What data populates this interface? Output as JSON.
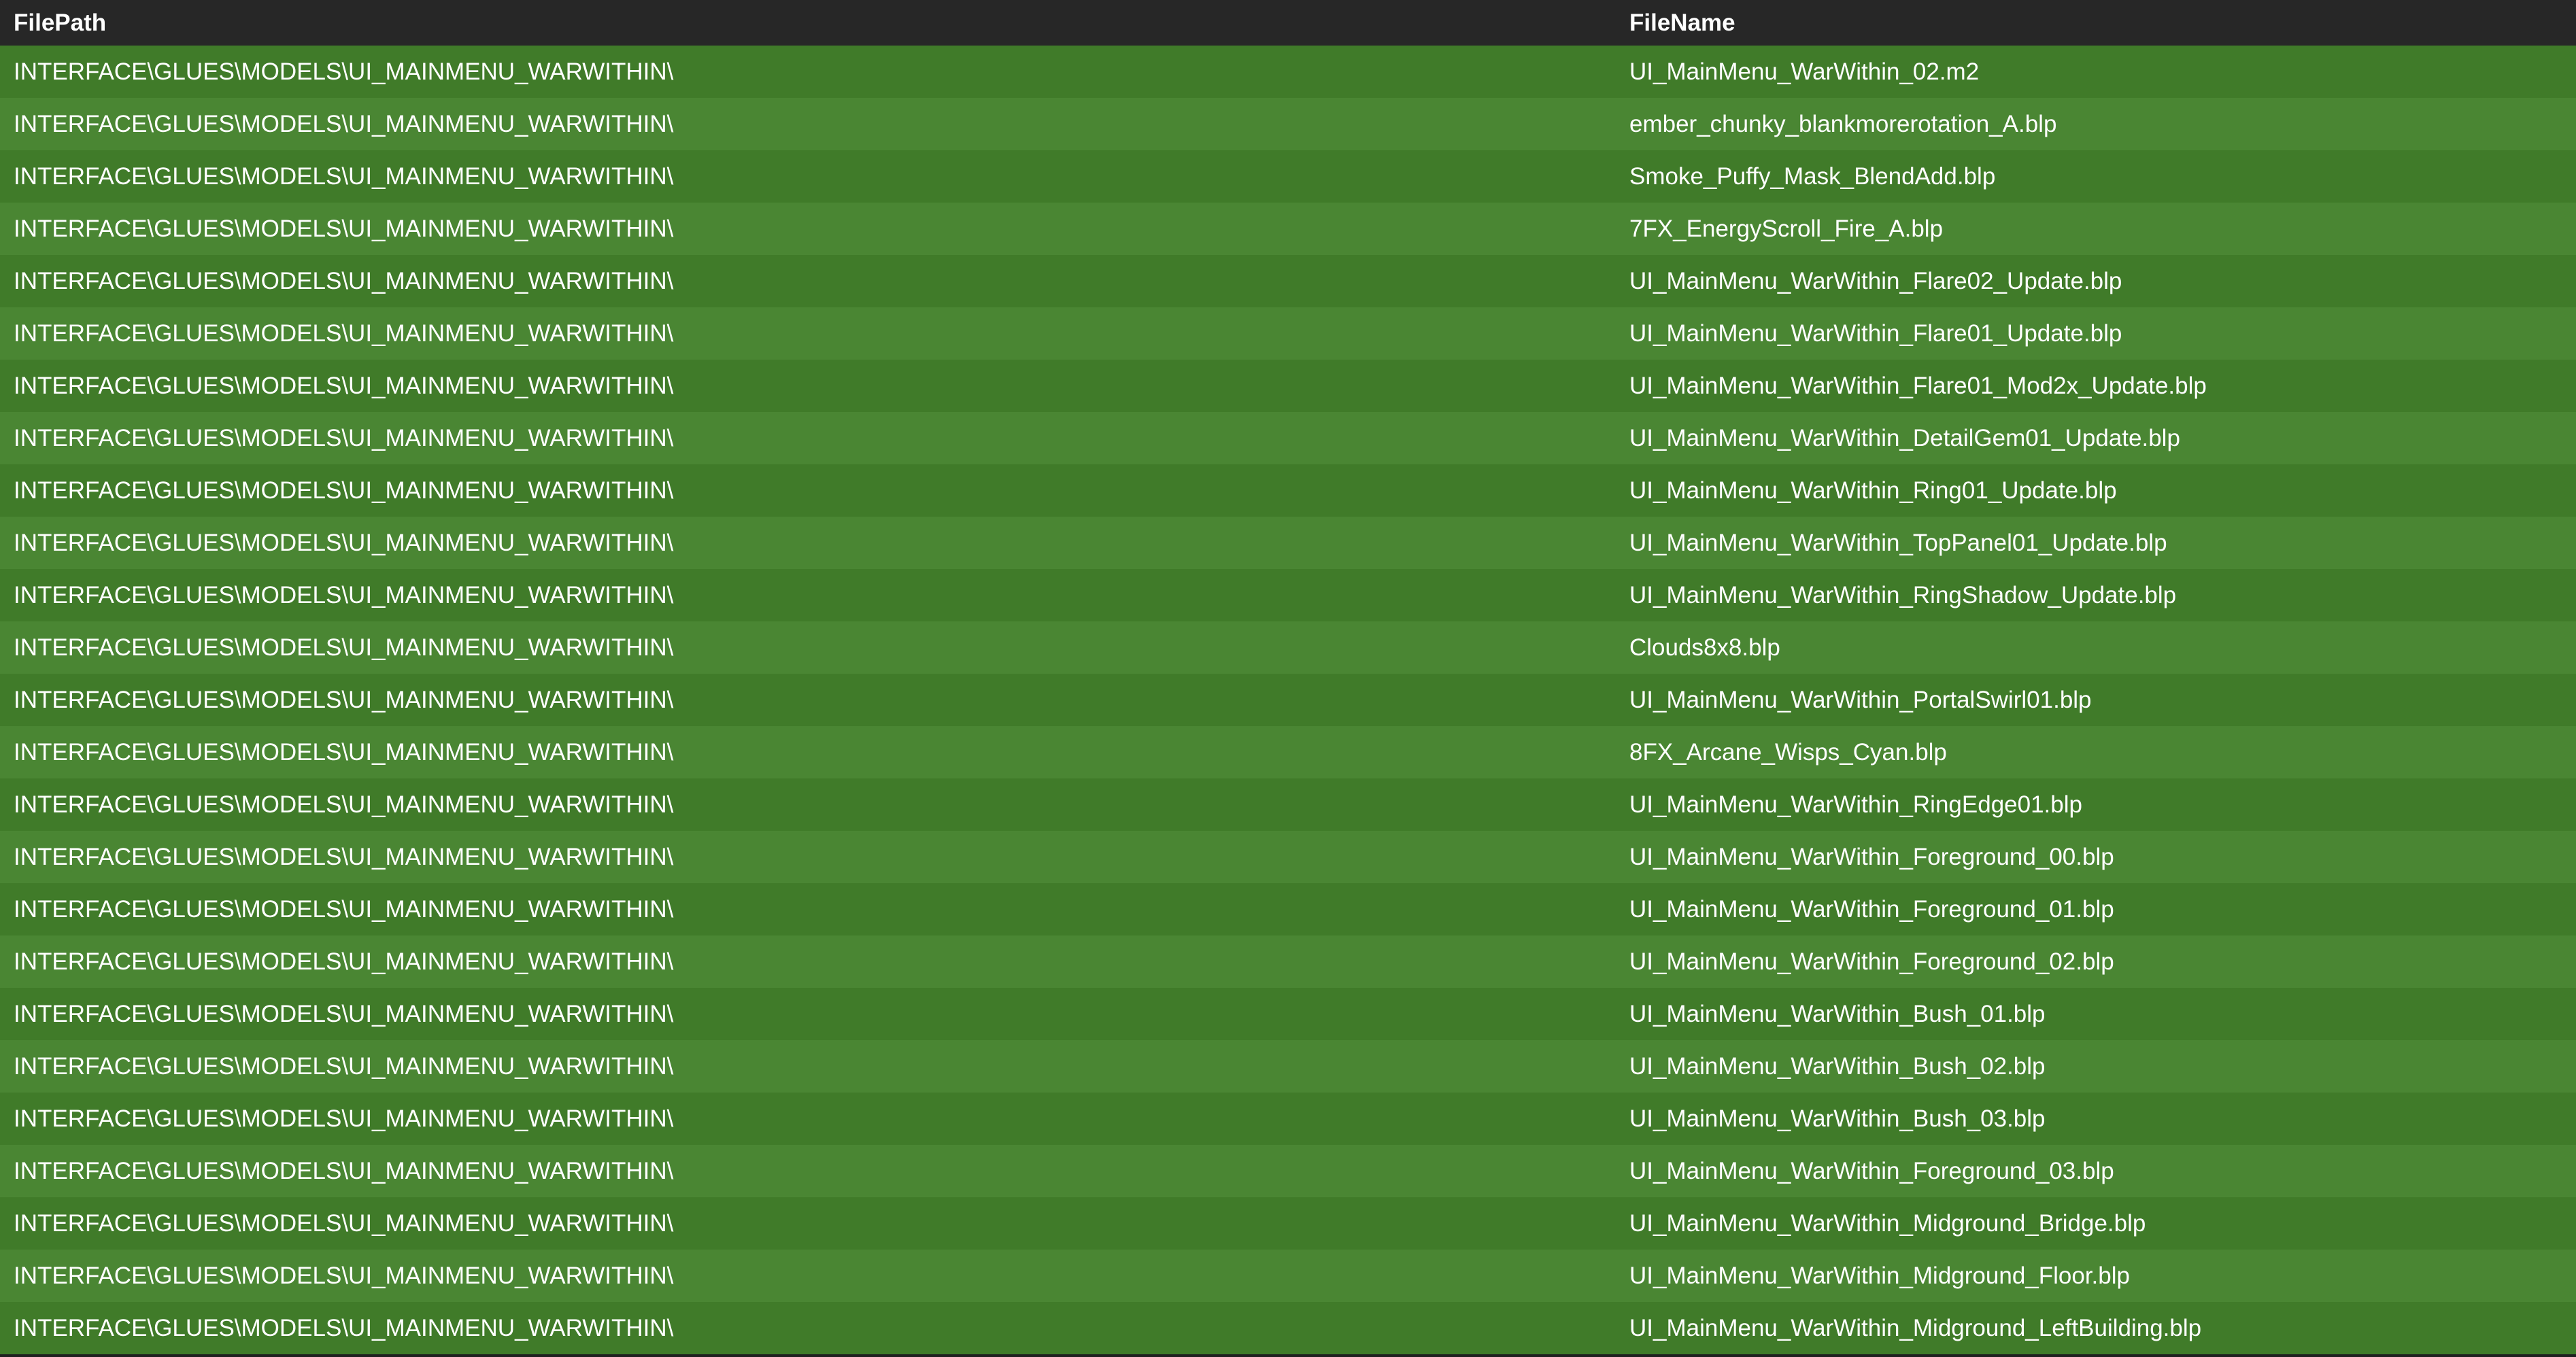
{
  "colors": {
    "header_bg": "#272727",
    "row_odd": "#407b29",
    "row_even": "#4a8633",
    "text": "#ffffff"
  },
  "table": {
    "columns": [
      "FilePath",
      "FileName"
    ],
    "rows": [
      {
        "path": "INTERFACE\\GLUES\\MODELS\\UI_MAINMENU_WARWITHIN\\",
        "name": "UI_MainMenu_WarWithin_02.m2"
      },
      {
        "path": "INTERFACE\\GLUES\\MODELS\\UI_MAINMENU_WARWITHIN\\",
        "name": "ember_chunky_blankmorerotation_A.blp"
      },
      {
        "path": "INTERFACE\\GLUES\\MODELS\\UI_MAINMENU_WARWITHIN\\",
        "name": "Smoke_Puffy_Mask_BlendAdd.blp"
      },
      {
        "path": "INTERFACE\\GLUES\\MODELS\\UI_MAINMENU_WARWITHIN\\",
        "name": "7FX_EnergyScroll_Fire_A.blp"
      },
      {
        "path": "INTERFACE\\GLUES\\MODELS\\UI_MAINMENU_WARWITHIN\\",
        "name": "UI_MainMenu_WarWithin_Flare02_Update.blp"
      },
      {
        "path": "INTERFACE\\GLUES\\MODELS\\UI_MAINMENU_WARWITHIN\\",
        "name": "UI_MainMenu_WarWithin_Flare01_Update.blp"
      },
      {
        "path": "INTERFACE\\GLUES\\MODELS\\UI_MAINMENU_WARWITHIN\\",
        "name": "UI_MainMenu_WarWithin_Flare01_Mod2x_Update.blp"
      },
      {
        "path": "INTERFACE\\GLUES\\MODELS\\UI_MAINMENU_WARWITHIN\\",
        "name": "UI_MainMenu_WarWithin_DetailGem01_Update.blp"
      },
      {
        "path": "INTERFACE\\GLUES\\MODELS\\UI_MAINMENU_WARWITHIN\\",
        "name": "UI_MainMenu_WarWithin_Ring01_Update.blp"
      },
      {
        "path": "INTERFACE\\GLUES\\MODELS\\UI_MAINMENU_WARWITHIN\\",
        "name": "UI_MainMenu_WarWithin_TopPanel01_Update.blp"
      },
      {
        "path": "INTERFACE\\GLUES\\MODELS\\UI_MAINMENU_WARWITHIN\\",
        "name": "UI_MainMenu_WarWithin_RingShadow_Update.blp"
      },
      {
        "path": "INTERFACE\\GLUES\\MODELS\\UI_MAINMENU_WARWITHIN\\",
        "name": "Clouds8x8.blp"
      },
      {
        "path": "INTERFACE\\GLUES\\MODELS\\UI_MAINMENU_WARWITHIN\\",
        "name": "UI_MainMenu_WarWithin_PortalSwirl01.blp"
      },
      {
        "path": "INTERFACE\\GLUES\\MODELS\\UI_MAINMENU_WARWITHIN\\",
        "name": "8FX_Arcane_Wisps_Cyan.blp"
      },
      {
        "path": "INTERFACE\\GLUES\\MODELS\\UI_MAINMENU_WARWITHIN\\",
        "name": "UI_MainMenu_WarWithin_RingEdge01.blp"
      },
      {
        "path": "INTERFACE\\GLUES\\MODELS\\UI_MAINMENU_WARWITHIN\\",
        "name": "UI_MainMenu_WarWithin_Foreground_00.blp"
      },
      {
        "path": "INTERFACE\\GLUES\\MODELS\\UI_MAINMENU_WARWITHIN\\",
        "name": "UI_MainMenu_WarWithin_Foreground_01.blp"
      },
      {
        "path": "INTERFACE\\GLUES\\MODELS\\UI_MAINMENU_WARWITHIN\\",
        "name": "UI_MainMenu_WarWithin_Foreground_02.blp"
      },
      {
        "path": "INTERFACE\\GLUES\\MODELS\\UI_MAINMENU_WARWITHIN\\",
        "name": "UI_MainMenu_WarWithin_Bush_01.blp"
      },
      {
        "path": "INTERFACE\\GLUES\\MODELS\\UI_MAINMENU_WARWITHIN\\",
        "name": "UI_MainMenu_WarWithin_Bush_02.blp"
      },
      {
        "path": "INTERFACE\\GLUES\\MODELS\\UI_MAINMENU_WARWITHIN\\",
        "name": "UI_MainMenu_WarWithin_Bush_03.blp"
      },
      {
        "path": "INTERFACE\\GLUES\\MODELS\\UI_MAINMENU_WARWITHIN\\",
        "name": "UI_MainMenu_WarWithin_Foreground_03.blp"
      },
      {
        "path": "INTERFACE\\GLUES\\MODELS\\UI_MAINMENU_WARWITHIN\\",
        "name": "UI_MainMenu_WarWithin_Midground_Bridge.blp"
      },
      {
        "path": "INTERFACE\\GLUES\\MODELS\\UI_MAINMENU_WARWITHIN\\",
        "name": "UI_MainMenu_WarWithin_Midground_Floor.blp"
      },
      {
        "path": "INTERFACE\\GLUES\\MODELS\\UI_MAINMENU_WARWITHIN\\",
        "name": "UI_MainMenu_WarWithin_Midground_LeftBuilding.blp"
      }
    ]
  }
}
